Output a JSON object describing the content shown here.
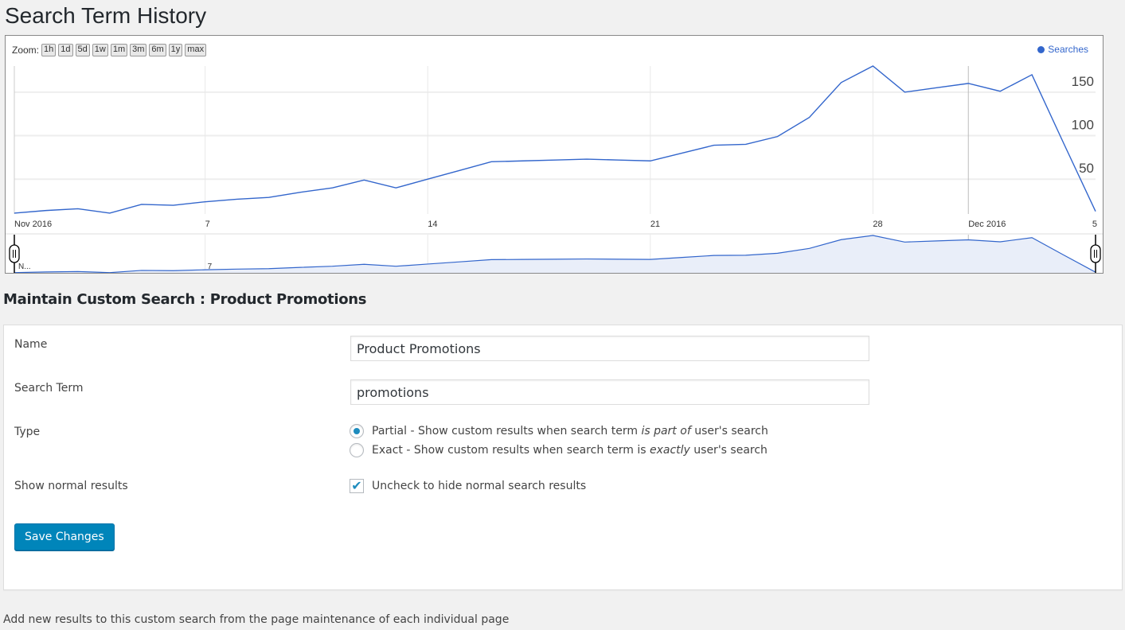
{
  "page_title": "Search Term History",
  "chart": {
    "zoom_label": "Zoom:",
    "zoom_buttons": [
      "1h",
      "1d",
      "5d",
      "1w",
      "1m",
      "3m",
      "6m",
      "1y",
      "max"
    ],
    "legend": "Searches",
    "nav_first_label": "N..."
  },
  "chart_data": {
    "type": "line",
    "series": [
      {
        "name": "Searches",
        "color": "#3366cc",
        "x": [
          "2016-11-01",
          "2016-11-02",
          "2016-11-03",
          "2016-11-04",
          "2016-11-05",
          "2016-11-06",
          "2016-11-07",
          "2016-11-08",
          "2016-11-09",
          "2016-11-10",
          "2016-11-11",
          "2016-11-12",
          "2016-11-13",
          "2016-11-14",
          "2016-11-15",
          "2016-11-16",
          "2016-11-17",
          "2016-11-18",
          "2016-11-19",
          "2016-11-20",
          "2016-11-21",
          "2016-11-22",
          "2016-11-23",
          "2016-11-24",
          "2016-11-25",
          "2016-11-26",
          "2016-11-27",
          "2016-11-28",
          "2016-11-29",
          "2016-11-30",
          "2016-12-01",
          "2016-12-02",
          "2016-12-03",
          "2016-12-04",
          "2016-12-05"
        ],
        "values": [
          11,
          14,
          16,
          11,
          21,
          20,
          24,
          27,
          29,
          35,
          40,
          49,
          40,
          50,
          60,
          70,
          71,
          72,
          73,
          72,
          71,
          80,
          89,
          90,
          99,
          121,
          161,
          180,
          150,
          155,
          160,
          151,
          170,
          91,
          13
        ]
      }
    ],
    "x_ticks": [
      {
        "label": "Nov 2016",
        "date": "2016-11-01"
      },
      {
        "label": "7",
        "date": "2016-11-07"
      },
      {
        "label": "14",
        "date": "2016-11-14"
      },
      {
        "label": "21",
        "date": "2016-11-21"
      },
      {
        "label": "28",
        "date": "2016-11-28"
      },
      {
        "label": "Dec 2016",
        "date": "2016-12-01"
      },
      {
        "label": "5",
        "date": "2016-12-05"
      }
    ],
    "y_ticks": [
      50,
      100,
      150
    ],
    "ylim": [
      10,
      180
    ],
    "xlim": [
      "2016-11-01",
      "2016-12-05"
    ],
    "grid": true,
    "legend_position": "top-right",
    "y_axis_side": "right",
    "navigator": true
  },
  "form": {
    "heading": "Maintain Custom Search : Product Promotions",
    "name_label": "Name",
    "name_value": "Product Promotions",
    "term_label": "Search Term",
    "term_value": "promotions",
    "type_label": "Type",
    "partial_a": "Partial - Show custom results when search term ",
    "partial_em": "is part of",
    "partial_b": " user's search",
    "partial_checked": true,
    "exact_a": "Exact - Show custom results when search term is ",
    "exact_em": "exactly",
    "exact_b": " user's search",
    "normal_label": "Show normal results",
    "normal_text": "Uncheck to hide normal search results",
    "normal_checked": true,
    "save_label": "Save Changes"
  },
  "footer_note": "Add new results to this custom search from the page maintenance of each individual page"
}
